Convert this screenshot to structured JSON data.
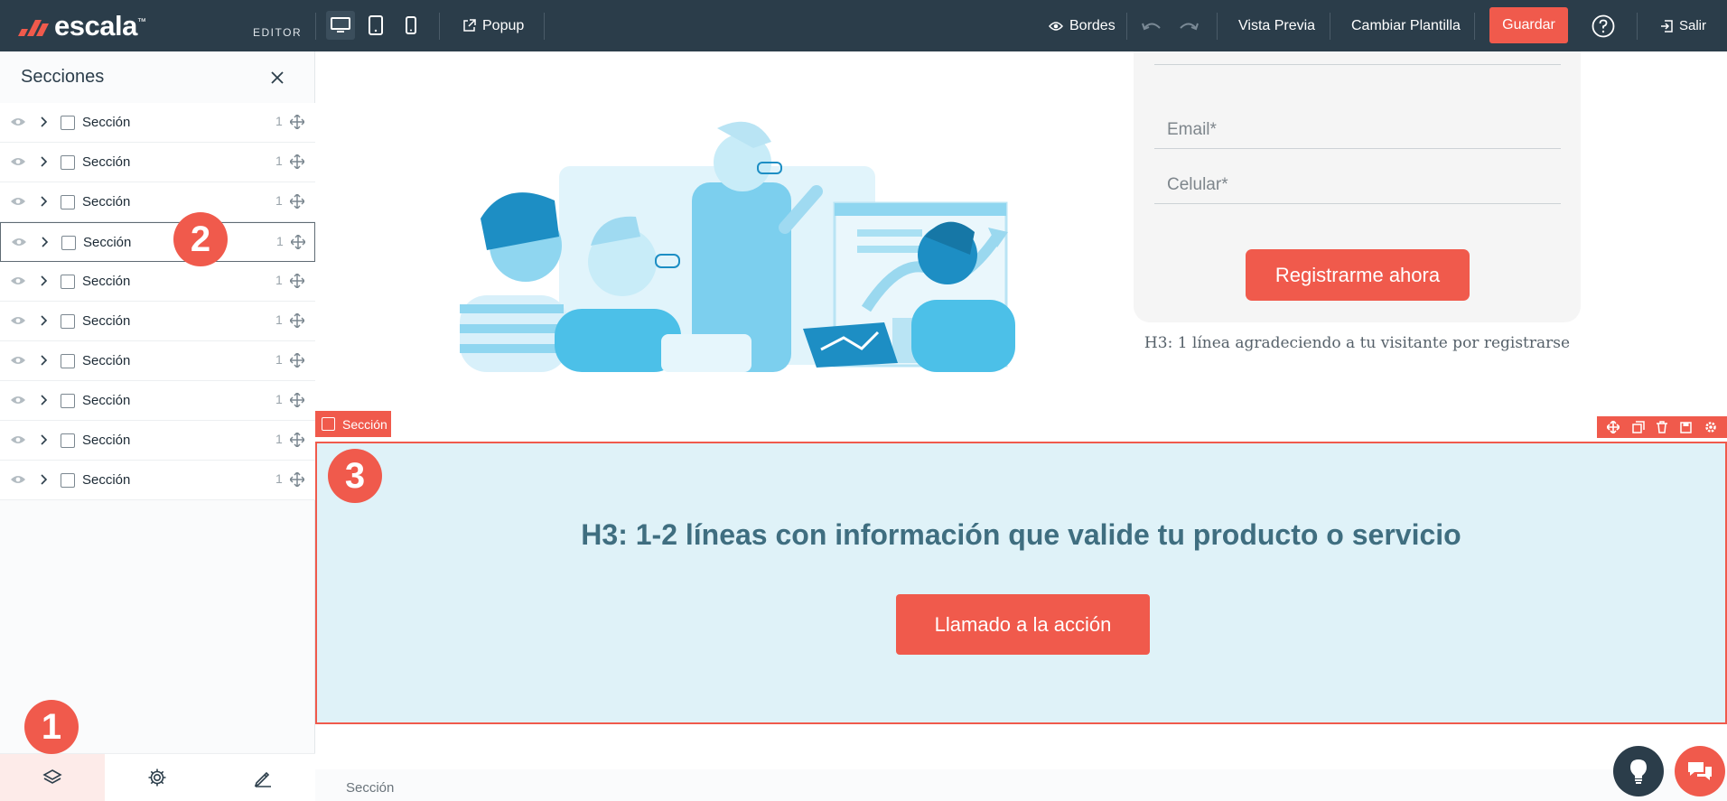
{
  "topbar": {
    "logo": "escala",
    "logo_mark": "™",
    "editor_label": "EDITOR",
    "popup_label": "Popup",
    "bordes_label": "Bordes",
    "preview_label": "Vista Previa",
    "template_label": "Cambiar Plantilla",
    "save_label": "Guardar",
    "help_icon": "question-circle",
    "exit_label": "Salir"
  },
  "sidebar": {
    "title": "Secciones",
    "sections": [
      {
        "label": "Sección",
        "count": "1"
      },
      {
        "label": "Sección",
        "count": "1"
      },
      {
        "label": "Sección",
        "count": "1"
      },
      {
        "label": "Sección",
        "count": "1"
      },
      {
        "label": "Sección",
        "count": "1"
      },
      {
        "label": "Sección",
        "count": "1"
      },
      {
        "label": "Sección",
        "count": "1"
      },
      {
        "label": "Sección",
        "count": "1"
      },
      {
        "label": "Sección",
        "count": "1"
      },
      {
        "label": "Sección",
        "count": "1"
      }
    ],
    "footer_tabs": [
      "layers-icon",
      "gear-icon",
      "pen-icon"
    ]
  },
  "badges": {
    "one": "1",
    "two": "2",
    "three": "3"
  },
  "form": {
    "email_placeholder": "Email*",
    "phone_placeholder": "Celular*",
    "submit_label": "Registrarme ahora",
    "thanks_note": "H3: 1 línea agradeciendo a tu visitante por registrarse"
  },
  "selected_section": {
    "label": "Sección",
    "heading": "H3: 1-2 líneas con información que valide tu producto o servicio",
    "cta_label": "Llamado a la acción"
  },
  "bottom": {
    "section_label": "Sección"
  },
  "colors": {
    "topbar": "#2b3d4a",
    "accent": "#f05a4c",
    "section_bg": "#dff2f8",
    "heading": "#3f6e80",
    "illustration": "#5cc6ea"
  }
}
